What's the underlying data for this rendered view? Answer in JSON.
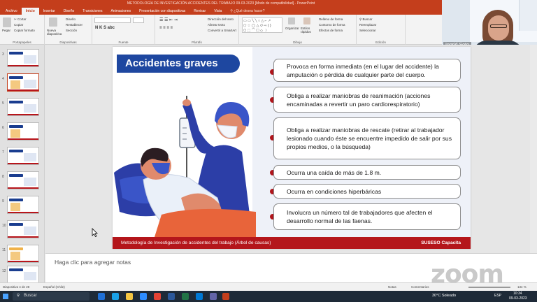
{
  "window": {
    "title": "METODOLOGÍA DE INVESTIGACIÓN ACCIDENTES DEL TRABAJO 09-03-2023 [Modo de compatibilidad] - PowerPoint"
  },
  "ribbon": {
    "tabs": [
      "Archivo",
      "Inicio",
      "Insertar",
      "Diseño",
      "Transiciones",
      "Animaciones",
      "Presentación con diapositivas",
      "Revisar",
      "Vista"
    ],
    "search": "¿Qué desea hacer?",
    "clipboard": {
      "paste": "Pegar",
      "cut": "Cortar",
      "copy": "Copiar",
      "format": "Copiar formato",
      "label": "Portapapeles"
    },
    "slides": {
      "new": "Nueva diapositiva",
      "layout": "Diseño",
      "reset": "Restablecer",
      "section": "Sección",
      "label": "Diapositivas"
    },
    "font_label": "Fuente",
    "paragraph": {
      "dir": "Dirección del texto",
      "align": "Alinear texto",
      "smart": "Convertir a SmartArt",
      "label": "Párrafo"
    },
    "drawing": {
      "arrange": "Organizar",
      "styles": "Estilos rápidos",
      "fill": "Relleno de forma",
      "outline": "Contorno de forma",
      "effects": "Efectos de forma",
      "label": "Dibujo"
    },
    "editing": {
      "find": "Buscar",
      "replace": "Reemplazar",
      "select": "Seleccionar",
      "label": "Edición"
    }
  },
  "video": {
    "name": "Ingrid Soto"
  },
  "thumbnails": [
    "3",
    "4",
    "5",
    "6",
    "7",
    "8",
    "9",
    "10",
    "11",
    "12"
  ],
  "slide": {
    "title": "Accidentes graves",
    "items": [
      "Provoca en forma inmediata (en el lugar del accidente) la amputación o pérdida de cualquier parte del cuerpo.",
      "Obliga a realizar maniobras de reanimación (acciones encaminadas a revertir un paro cardiorespiratorio)",
      "Obliga a realizar maniobras de rescate (retirar al trabajador lesionado cuando éste se encuentre impedido de salir por sus propios medios, o la búsqueda)",
      "Ocurra una caída de más de 1.8 m.",
      "Ocurra en condiciones hiperbáricas",
      "Involucra un número tal de trabajadores que afecten el desarrollo normal de las faenas."
    ],
    "footer_left": "Metodología de Investigación de accidentes del trabajo (Árbol de causas)",
    "footer_right": "SUSESO Capacita"
  },
  "notes": {
    "placeholder": "Haga clic para agregar notas"
  },
  "zoom": {
    "logo": "zoom"
  },
  "status": {
    "slide": "Diapositiva 4 de 28",
    "lang": "Español (Chile)",
    "notes": "Notas",
    "comments": "Comentarios",
    "zoom": "134 %"
  },
  "taskbar": {
    "search": "Buscar",
    "weather": "30°C Soleado",
    "time": "10:34",
    "date": "09-03-2023",
    "lang": "ESP"
  },
  "colors": {
    "accent": "#c43e1c",
    "slide_blue": "#1e47a0",
    "slide_red": "#b4161b"
  }
}
